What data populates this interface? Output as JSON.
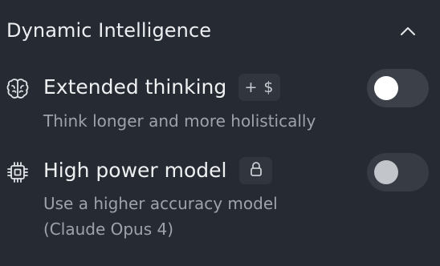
{
  "section": {
    "title": "Dynamic Intelligence",
    "collapse_icon": "chevron-up-icon"
  },
  "settings": [
    {
      "icon": "brain-icon",
      "title": "Extended thinking",
      "badge": "+ $",
      "description": "Think longer and more holistically",
      "toggle_on": false,
      "toggle_enabled": true
    },
    {
      "icon": "chip-icon",
      "title": "High power model",
      "badge_icon": "lock-icon",
      "description_lines": [
        "Use a higher accuracy model",
        "(Claude Opus 4)"
      ],
      "toggle_on": false,
      "toggle_enabled": false
    }
  ],
  "colors": {
    "background": "#262a32",
    "badge_background": "#30353e",
    "toggle_track": "#3b4049",
    "toggle_knob": "#ffffff",
    "toggle_knob_disabled": "#c2c5ca",
    "secondary_text": "#9ea3ab"
  }
}
